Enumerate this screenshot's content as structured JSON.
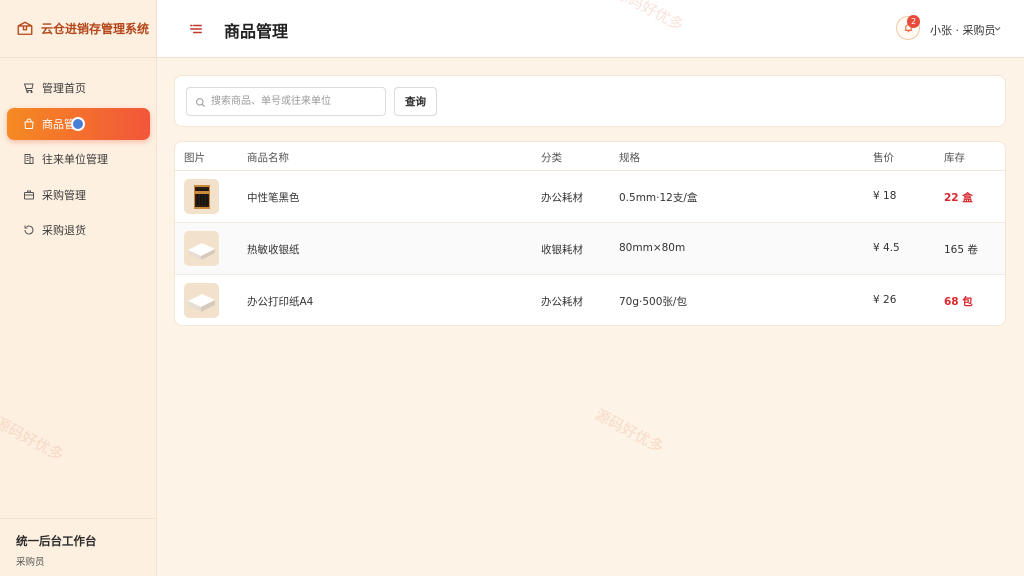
{
  "app": {
    "title": "云仓进销存管理系统"
  },
  "sidebar": {
    "items": [
      {
        "label": "管理首页",
        "icon": "home-cart-icon",
        "active": false
      },
      {
        "label": "商品管",
        "icon": "shopping-bag-icon",
        "active": true
      },
      {
        "label": "往来单位管理",
        "icon": "building-icon",
        "active": false
      },
      {
        "label": "采购管理",
        "icon": "briefcase-icon",
        "active": false
      },
      {
        "label": "采购退货",
        "icon": "return-icon",
        "active": false
      }
    ],
    "footer": {
      "title": "统一后台工作台",
      "subtitle": "采购员"
    }
  },
  "header": {
    "title": "商品管理",
    "notification_count": "2",
    "user_label": "小张 · 采购员"
  },
  "search": {
    "placeholder": "搜索商品、单号或往来单位",
    "value": "",
    "button_label": "查询"
  },
  "table": {
    "columns": [
      "图片",
      "商品名称",
      "分类",
      "规格",
      "售价",
      "库存"
    ],
    "rows": [
      {
        "image": "black-gel-pens-box",
        "name": "中性笔黑色",
        "category": "办公耗材",
        "spec": "0.5mm·12支/盒",
        "price": "¥ 18",
        "stock": "22 盒",
        "low_stock": true
      },
      {
        "image": "thermal-paper-roll-box",
        "name": "热敏收银纸",
        "category": "收银耗材",
        "spec": "80mm×80m",
        "price": "¥ 4.5",
        "stock": "165 卷",
        "low_stock": false
      },
      {
        "image": "a4-paper-pack",
        "name": "办公打印纸A4",
        "category": "办公耗材",
        "spec": "70g·500张/包",
        "price": "¥ 26",
        "stock": "68 包",
        "low_stock": true
      }
    ]
  },
  "watermark": "源码好优多",
  "colors": {
    "accent_start": "#f58a22",
    "accent_end": "#f2563a",
    "brand_text": "#b4471a",
    "low_stock": "#d9262b",
    "badge": "#e84a3b"
  }
}
